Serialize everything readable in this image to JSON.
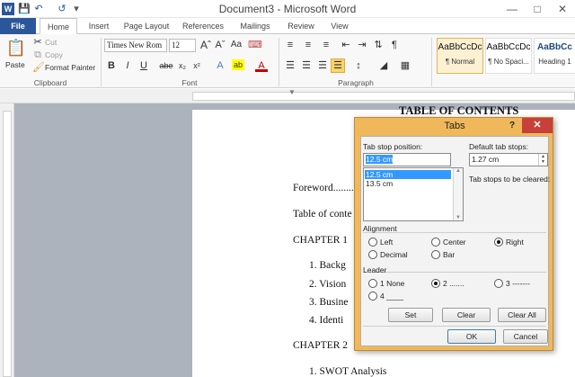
{
  "title_bar": {
    "title": "Document3 - Microsoft Word",
    "qat": [
      "word-icon",
      "save-icon",
      "undo-icon",
      "redo-icon",
      "customize-icon"
    ]
  },
  "tabs": [
    {
      "label": "File"
    },
    {
      "label": "Home"
    },
    {
      "label": "Insert"
    },
    {
      "label": "Page Layout"
    },
    {
      "label": "References"
    },
    {
      "label": "Mailings"
    },
    {
      "label": "Review"
    },
    {
      "label": "View"
    }
  ],
  "ribbon": {
    "clipboard": {
      "paste": "Paste",
      "cut": "Cut",
      "copy": "Copy",
      "format_painter": "Format Painter",
      "label": "Clipboard"
    },
    "font": {
      "font_name": "Times New Rom",
      "font_size": "12",
      "label": "Font",
      "bold": "B",
      "italic": "I",
      "underline": "U",
      "strike": "abe",
      "sub": "x₂",
      "sup": "x²"
    },
    "paragraph": {
      "label": "Paragraph",
      "pilcrow": "¶"
    },
    "styles": [
      {
        "preview": "AaBbCcDc",
        "name": "¶ Normal"
      },
      {
        "preview": "AaBbCcDc",
        "name": "¶ No Spaci..."
      },
      {
        "preview": "AaBbCc",
        "name": "Heading 1"
      }
    ]
  },
  "document": {
    "heading": "TABLE OF CONTENTS",
    "lines": [
      {
        "text": "Foreword........"
      },
      {
        "text": "Table of conte"
      },
      {
        "text": "CHAPTER 1"
      },
      {
        "text": "1.   Backg"
      },
      {
        "text": "2.   Vision"
      },
      {
        "text": "3.   Busine"
      },
      {
        "text": "4.   Identi"
      },
      {
        "text": "CHAPTER 2"
      },
      {
        "text": "1.   SWOT Analysis"
      }
    ]
  },
  "tabs_dialog": {
    "title": "Tabs",
    "help": "?",
    "close": "✕",
    "tab_stop_position_label": "Tab stop position:",
    "tab_stop_position_value": "12.5 cm",
    "tab_stop_list": [
      "12.5 cm",
      "13.5 cm"
    ],
    "default_tab_stops_label": "Default tab stops:",
    "default_tab_stops_value": "1.27 cm",
    "cleared_label": "Tab stops to be cleared:",
    "alignment_label": "Alignment",
    "alignment_options": [
      {
        "label": "Left",
        "selected": false
      },
      {
        "label": "Center",
        "selected": false
      },
      {
        "label": "Right",
        "selected": true
      },
      {
        "label": "Decimal",
        "selected": false
      },
      {
        "label": "Bar",
        "selected": false
      }
    ],
    "leader_label": "Leader",
    "leader_options": [
      {
        "label": "1 None",
        "selected": false
      },
      {
        "label": "2 .......",
        "selected": true
      },
      {
        "label": "3 -------",
        "selected": false
      },
      {
        "label": "4 ____",
        "selected": false
      }
    ],
    "buttons": {
      "set": "Set",
      "clear": "Clear",
      "clear_all": "Clear All",
      "ok": "OK",
      "cancel": "Cancel"
    }
  }
}
